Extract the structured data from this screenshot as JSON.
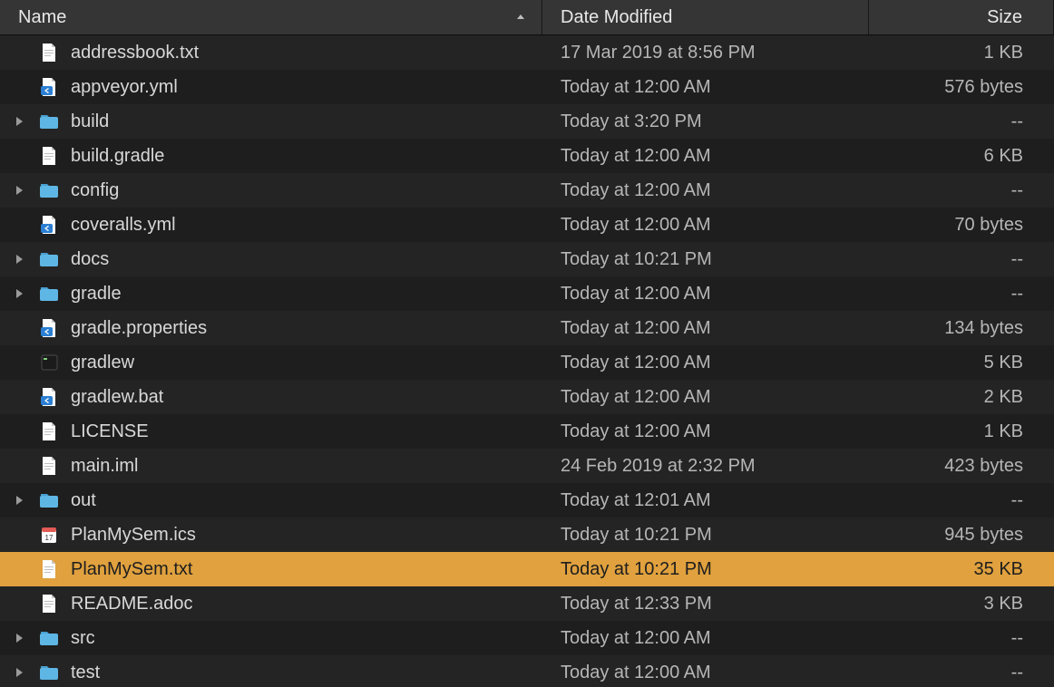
{
  "columns": {
    "name": "Name",
    "date_modified": "Date Modified",
    "size": "Size",
    "sort_column": "name",
    "sort_direction": "asc"
  },
  "rows": [
    {
      "name": "addressbook.txt",
      "date": "17 Mar 2019 at 8:56 PM",
      "size": "1 KB",
      "type": "text-file",
      "is_folder": false,
      "selected": false
    },
    {
      "name": "appveyor.yml",
      "date": "Today at 12:00 AM",
      "size": "576 bytes",
      "type": "yml-file",
      "is_folder": false,
      "selected": false
    },
    {
      "name": "build",
      "date": "Today at 3:20 PM",
      "size": "--",
      "type": "folder",
      "is_folder": true,
      "selected": false
    },
    {
      "name": "build.gradle",
      "date": "Today at 12:00 AM",
      "size": "6 KB",
      "type": "text-file",
      "is_folder": false,
      "selected": false
    },
    {
      "name": "config",
      "date": "Today at 12:00 AM",
      "size": "--",
      "type": "folder",
      "is_folder": true,
      "selected": false
    },
    {
      "name": "coveralls.yml",
      "date": "Today at 12:00 AM",
      "size": "70 bytes",
      "type": "yml-file",
      "is_folder": false,
      "selected": false
    },
    {
      "name": "docs",
      "date": "Today at 10:21 PM",
      "size": "--",
      "type": "folder",
      "is_folder": true,
      "selected": false
    },
    {
      "name": "gradle",
      "date": "Today at 12:00 AM",
      "size": "--",
      "type": "folder",
      "is_folder": true,
      "selected": false
    },
    {
      "name": "gradle.properties",
      "date": "Today at 12:00 AM",
      "size": "134 bytes",
      "type": "yml-file",
      "is_folder": false,
      "selected": false
    },
    {
      "name": "gradlew",
      "date": "Today at 12:00 AM",
      "size": "5 KB",
      "type": "exec-file",
      "is_folder": false,
      "selected": false
    },
    {
      "name": "gradlew.bat",
      "date": "Today at 12:00 AM",
      "size": "2 KB",
      "type": "yml-file",
      "is_folder": false,
      "selected": false
    },
    {
      "name": "LICENSE",
      "date": "Today at 12:00 AM",
      "size": "1 KB",
      "type": "text-file",
      "is_folder": false,
      "selected": false
    },
    {
      "name": "main.iml",
      "date": "24 Feb 2019 at 2:32 PM",
      "size": "423 bytes",
      "type": "text-file",
      "is_folder": false,
      "selected": false
    },
    {
      "name": "out",
      "date": "Today at 12:01 AM",
      "size": "--",
      "type": "folder",
      "is_folder": true,
      "selected": false
    },
    {
      "name": "PlanMySem.ics",
      "date": "Today at 10:21 PM",
      "size": "945 bytes",
      "type": "ics-file",
      "is_folder": false,
      "selected": false
    },
    {
      "name": "PlanMySem.txt",
      "date": "Today at 10:21 PM",
      "size": "35 KB",
      "type": "text-file",
      "is_folder": false,
      "selected": true
    },
    {
      "name": "README.adoc",
      "date": "Today at 12:33 PM",
      "size": "3 KB",
      "type": "text-file",
      "is_folder": false,
      "selected": false
    },
    {
      "name": "src",
      "date": "Today at 12:00 AM",
      "size": "--",
      "type": "folder",
      "is_folder": true,
      "selected": false
    },
    {
      "name": "test",
      "date": "Today at 12:00 AM",
      "size": "--",
      "type": "folder",
      "is_folder": true,
      "selected": false
    }
  ]
}
